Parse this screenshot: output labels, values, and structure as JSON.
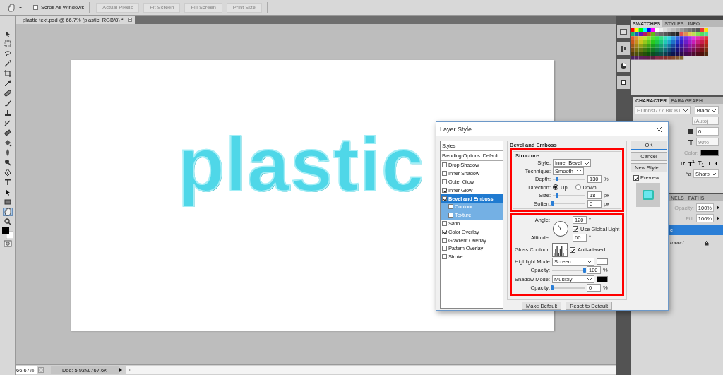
{
  "options_bar": {
    "scroll_all_windows": {
      "label": "Scroll All Windows",
      "checked": false
    },
    "buttons": [
      {
        "label": "Actual Pixels",
        "disabled": true
      },
      {
        "label": "Fit Screen",
        "disabled": true
      },
      {
        "label": "Fill Screen",
        "disabled": true
      },
      {
        "label": "Print Size",
        "disabled": true
      }
    ]
  },
  "document_tab": {
    "title": "plastic text.psd @ 66.7% (plastic, RGB/8) *"
  },
  "toolbar": {
    "tools": [
      {
        "selected": false
      },
      {
        "selected": false
      },
      {
        "selected": false
      },
      {
        "selected": false
      },
      {
        "selected": false
      },
      {
        "selected": false
      },
      {
        "selected": false
      },
      {
        "selected": false
      },
      {
        "selected": false
      },
      {
        "selected": false
      },
      {
        "selected": false
      },
      {
        "selected": false
      },
      {
        "selected": false
      },
      {
        "selected": false
      },
      {
        "selected": false
      },
      {
        "selected": false
      },
      {
        "selected": false
      },
      {
        "selected": false
      },
      {
        "selected": true
      },
      {
        "selected": false
      }
    ]
  },
  "canvas": {
    "text": "plastic"
  },
  "status_bar": {
    "zoom": "66.67%",
    "doc_info": "Doc: 5.93M/767.6K"
  },
  "swatches_panel": {
    "tabs": [
      {
        "label": "SWATCHES",
        "selected": true
      },
      {
        "label": "STYLES",
        "selected": false
      },
      {
        "label": "INFO",
        "selected": false
      }
    ]
  },
  "character_panel": {
    "tabs": [
      {
        "label": "CHARACTER",
        "selected": true
      },
      {
        "label": "PARAGRAPH",
        "selected": false
      }
    ],
    "font_family": "Humnst777 Blk BT",
    "font_style": "Black",
    "leading": "(Auto)",
    "tracking": "0",
    "horizontal_scale": "90%",
    "color_label": "Color:",
    "style_buttons": [
      "Tr",
      "T$^{1}$",
      "T$_{1}$",
      "T",
      "Ŧ"
    ],
    "antialias_label": "ªa",
    "antialias": "Sharp"
  },
  "layers_panel": {
    "tabs": [
      {
        "label": "NELS",
        "selected": false
      },
      {
        "label": "PATHS",
        "selected": false
      }
    ],
    "opacity_label": "Opacity:",
    "opacity": "100%",
    "fill_label": "Fill:",
    "fill": "100%",
    "layers": [
      {
        "name": "c",
        "selected": true,
        "locked": false
      },
      {
        "name": "round",
        "selected": false,
        "locked": true
      }
    ]
  },
  "dialog": {
    "title": "Layer Style",
    "styles_list": [
      {
        "label": "Styles",
        "kind": "header"
      },
      {
        "label": "Blending Options: Default",
        "kind": "header"
      },
      {
        "label": "Drop Shadow",
        "kind": "effect",
        "checked": false,
        "selected": false
      },
      {
        "label": "Inner Shadow",
        "kind": "effect",
        "checked": false,
        "selected": false
      },
      {
        "label": "Outer Glow",
        "kind": "effect",
        "checked": false,
        "selected": false
      },
      {
        "label": "Inner Glow",
        "kind": "effect",
        "checked": true,
        "selected": false
      },
      {
        "label": "Bevel and Emboss",
        "kind": "effect",
        "checked": true,
        "selected": true
      },
      {
        "label": "Contour",
        "kind": "sub",
        "checked": false,
        "selected": false
      },
      {
        "label": "Texture",
        "kind": "sub",
        "checked": false,
        "selected": false
      },
      {
        "label": "Satin",
        "kind": "effect",
        "checked": false,
        "selected": false
      },
      {
        "label": "Color Overlay",
        "kind": "effect",
        "checked": true,
        "selected": false
      },
      {
        "label": "Gradient Overlay",
        "kind": "effect",
        "checked": false,
        "selected": false
      },
      {
        "label": "Pattern Overlay",
        "kind": "effect",
        "checked": false,
        "selected": false
      },
      {
        "label": "Stroke",
        "kind": "effect",
        "checked": false,
        "selected": false
      }
    ],
    "group_title": "Bevel and Emboss",
    "structure_title": "Structure",
    "style": {
      "label": "Style:",
      "value": "Inner Bevel"
    },
    "technique": {
      "label": "Technique:",
      "value": "Smooth"
    },
    "depth": {
      "label": "Depth:",
      "level": 0.12,
      "value": "130",
      "unit": "%"
    },
    "direction": {
      "label": "Direction:",
      "options": [
        {
          "label": "Up",
          "selected": true
        },
        {
          "label": "Down",
          "selected": false
        }
      ]
    },
    "size": {
      "label": "Size:",
      "level": 0.12,
      "value": "18",
      "unit": "px"
    },
    "soften": {
      "label": "Soften:",
      "level": 0,
      "value": "0",
      "unit": "px"
    },
    "angle": {
      "label": "Angle:",
      "value": "120",
      "unit": "°"
    },
    "use_global_light": {
      "label": "Use Global Light",
      "checked": true
    },
    "altitude": {
      "label": "Altitude:",
      "value": "60",
      "unit": "°"
    },
    "gloss_contour": {
      "label": "Gloss Contour:"
    },
    "anti_aliased": {
      "label": "Anti-aliased",
      "checked": true
    },
    "highlight_mode": {
      "label": "Highlight Mode:",
      "value": "Screen"
    },
    "highlight_opacity": {
      "label": "Opacity:",
      "level": 1,
      "value": "100",
      "unit": "%"
    },
    "shadow_mode": {
      "label": "Shadow Mode:",
      "value": "Multiply"
    },
    "shadow_opacity": {
      "label": "Opacity:",
      "level": 0,
      "value": "0",
      "unit": "%"
    },
    "bottom_buttons": [
      "Make Default",
      "Reset to Default"
    ],
    "side_buttons": [
      {
        "label": "OK",
        "default": true
      },
      {
        "label": "Cancel",
        "default": false
      },
      {
        "label": "New Style...",
        "default": false
      }
    ],
    "preview": {
      "label": "Preview",
      "checked": true
    }
  }
}
